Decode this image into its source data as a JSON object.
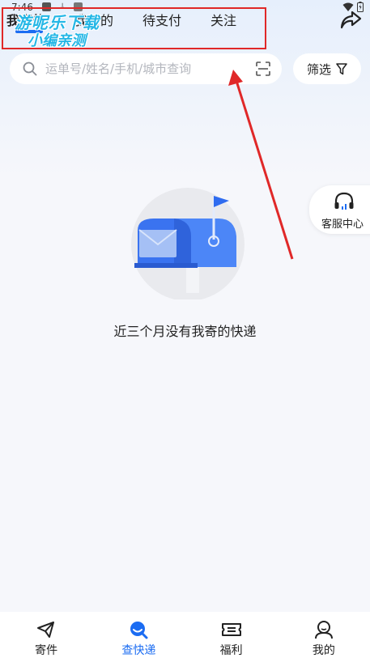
{
  "status_bar": {
    "time": "7:46"
  },
  "tabs": [
    {
      "label": "我寄的",
      "active": true
    },
    {
      "label": "我收的",
      "active": false
    },
    {
      "label": "待支付",
      "active": false
    },
    {
      "label": "关注",
      "active": false
    }
  ],
  "watermark": {
    "line1": "游呢乐下载",
    "line2": "小编亲测"
  },
  "search": {
    "placeholder": "运单号/姓名/手机/城市查询",
    "value": ""
  },
  "filter": {
    "label": "筛选",
    "icon": "funnel-icon"
  },
  "empty_state": {
    "message": "近三个月没有我寄的快递"
  },
  "service": {
    "label": "客服中心",
    "icon": "headset-icon"
  },
  "bottom_nav": [
    {
      "label": "寄件",
      "icon": "paper-plane-icon",
      "active": false
    },
    {
      "label": "查快递",
      "icon": "search-package-icon",
      "active": true
    },
    {
      "label": "福利",
      "icon": "ticket-icon",
      "active": false
    },
    {
      "label": "我的",
      "icon": "user-icon",
      "active": false
    }
  ],
  "colors": {
    "accent": "#1b6cf2",
    "annotation": "#e02828",
    "watermark": "#25b7e6"
  }
}
